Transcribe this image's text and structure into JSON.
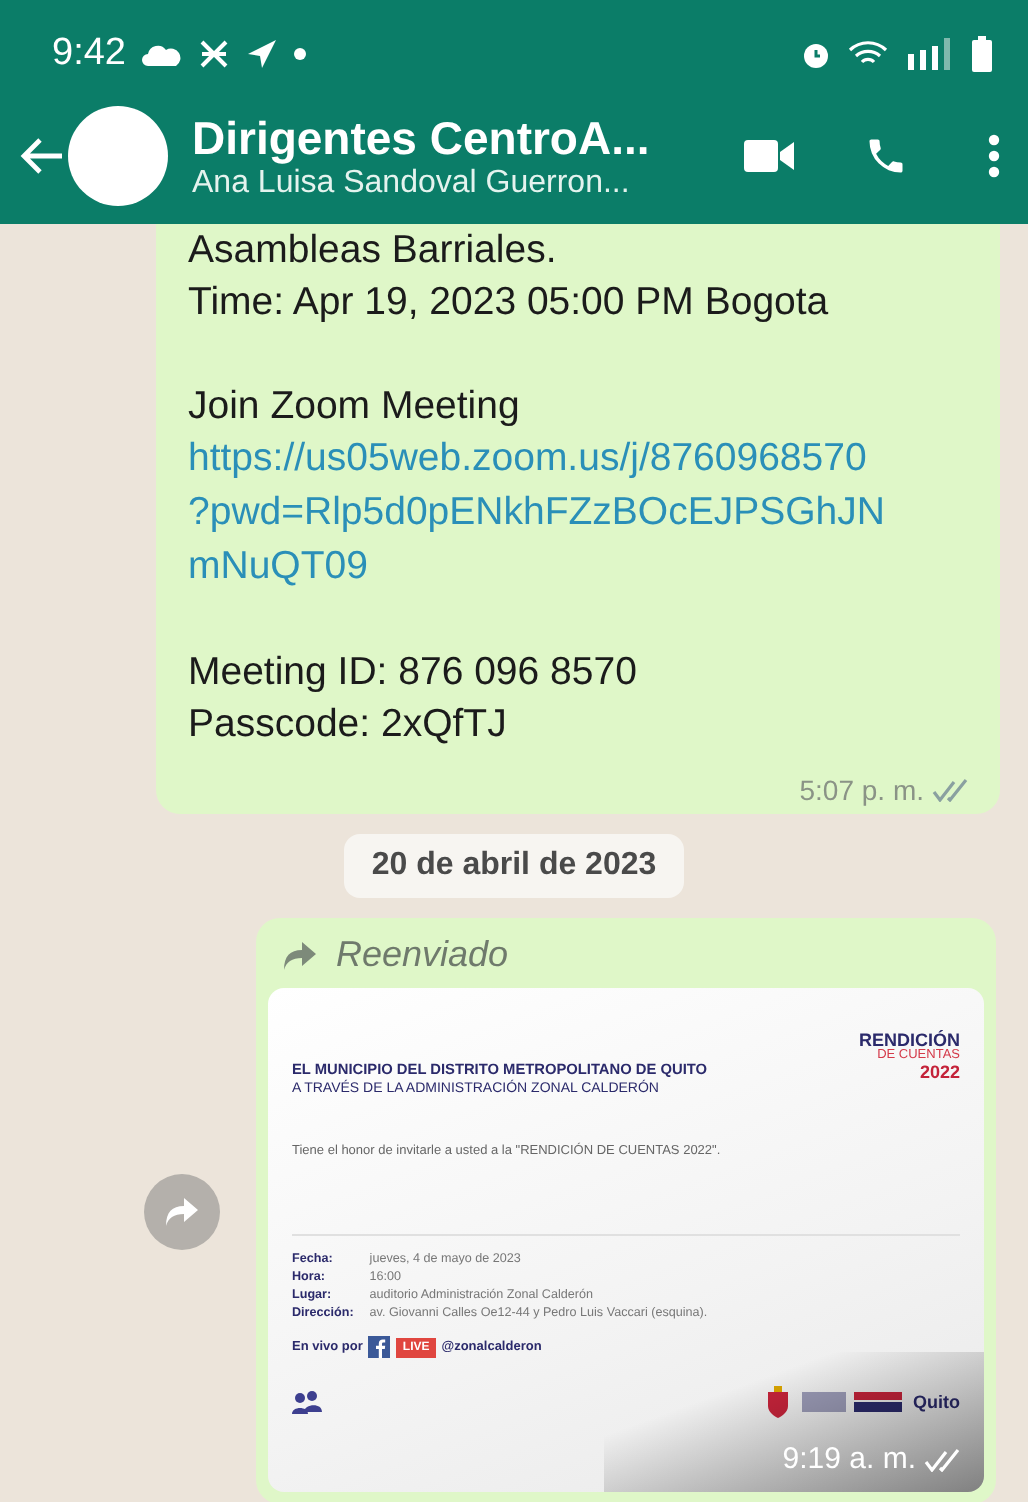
{
  "status_bar": {
    "time": "9:42"
  },
  "header": {
    "title": "Dirigentes CentroA...",
    "subtitle": "Ana Luisa Sandoval Guerron..."
  },
  "messages": [
    {
      "kind": "text",
      "paragraphs": [
        [
          {
            "kind": "line",
            "text": "Asambleas Barriales."
          },
          {
            "kind": "line",
            "text": "Time: Apr 19, 2023 05:00 PM Bogota"
          }
        ],
        [
          {
            "kind": "line",
            "text": "Join Zoom Meeting"
          },
          {
            "kind": "link",
            "lines": [
              "https://us05web.zoom.us/j/8760968570",
              "?pwd=Rlp5d0pENkhFZzBOcEJPSGhJN",
              "mNuQT09"
            ]
          }
        ],
        [
          {
            "kind": "line",
            "text": "Meeting ID: 876 096 8570"
          },
          {
            "kind": "line",
            "text": "Passcode: 2xQfTJ"
          }
        ]
      ],
      "time": "5:07 p. m.",
      "read": false
    },
    {
      "kind": "date",
      "text": "20 de abril de 2023"
    },
    {
      "kind": "image",
      "forwarded": true,
      "forwarded_label": "Reenviado",
      "time": "9:19 a. m.",
      "read": false,
      "invitation": {
        "brand": {
          "title": "RENDICIÓN",
          "subtitle": "DE CUENTAS",
          "year": "2022"
        },
        "heading": "EL MUNICIPIO DEL DISTRITO METROPOLITANO DE QUITO",
        "subheading": "A TRAVÉS DE LA ADMINISTRACIÓN ZONAL CALDERÓN",
        "text": "Tiene el honor de invitarle a usted a la \"RENDICIÓN DE CUENTAS 2022\".",
        "details": [
          {
            "label": "Fecha:",
            "value": "jueves, 4 de mayo de 2023"
          },
          {
            "label": "Hora:",
            "value": "16:00"
          },
          {
            "label": "Lugar:",
            "value": "auditorio Administración Zonal Calderón"
          },
          {
            "label": "Dirección:",
            "value": "av. Giovanni Calles Oe12-44 y Pedro Luis Vaccari (esquina)."
          }
        ],
        "live": {
          "prefix": "En vivo por",
          "badge": "LIVE",
          "handle": "@zonalcalderon"
        },
        "city_logo": "Quito"
      }
    }
  ]
}
